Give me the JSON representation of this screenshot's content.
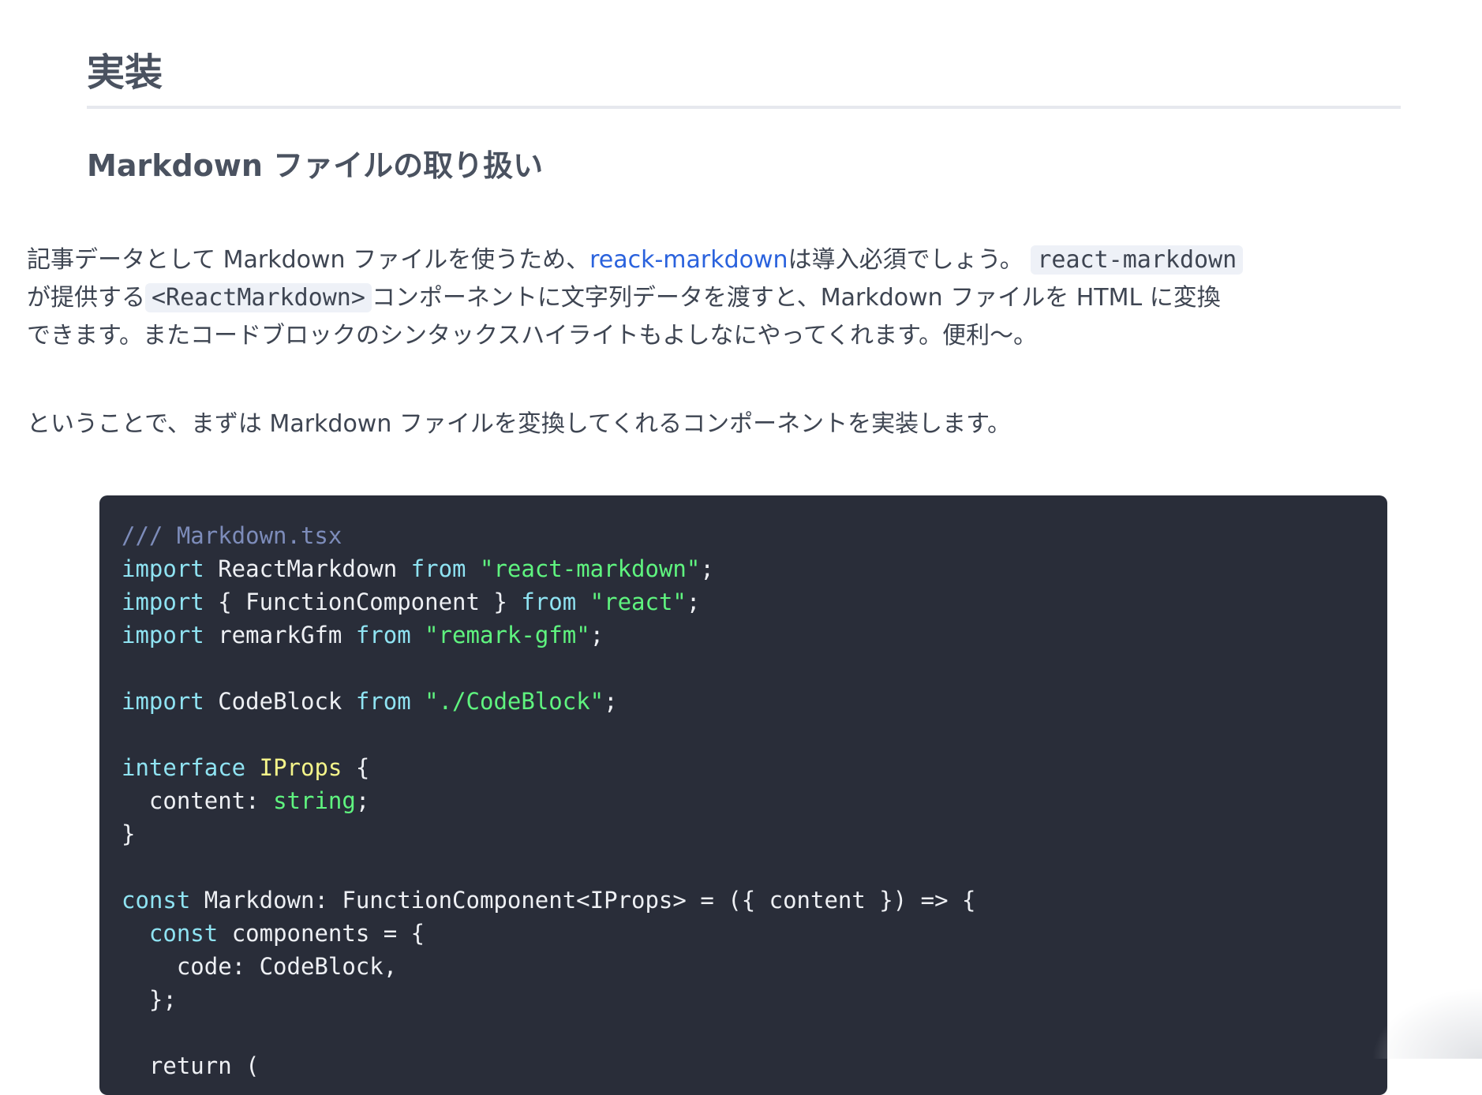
{
  "heading_h2": "実装",
  "heading_h3": "Markdown ファイルの取り扱い",
  "para1": {
    "t1": "記事データとして Markdown ファイルを使うため、",
    "link": "reack-markdown",
    "t2": "は導入必須でしょう。",
    "code1": "react-markdown",
    "t3": "が提供する",
    "code2": "<ReactMarkdown>",
    "t4": "コンポーネントに文字列データを渡すと、Markdown ファイルを HTML に変換",
    "t5": "できます。またコードブロックのシンタックスハイライトもよしなにやってくれます。便利〜。"
  },
  "para2": "ということで、まずは Markdown ファイルを変換してくれるコンポーネントを実装します。",
  "code": {
    "l1": "/// Markdown.tsx",
    "l2": [
      {
        "t": "import",
        "c": "kw"
      },
      {
        "t": " ReactMarkdown ",
        "c": ""
      },
      {
        "t": "from",
        "c": "kw"
      },
      {
        "t": " ",
        "c": ""
      },
      {
        "t": "\"react-markdown\"",
        "c": "str"
      },
      {
        "t": ";",
        "c": ""
      }
    ],
    "l3": [
      {
        "t": "import",
        "c": "kw"
      },
      {
        "t": " { FunctionComponent } ",
        "c": ""
      },
      {
        "t": "from",
        "c": "kw"
      },
      {
        "t": " ",
        "c": ""
      },
      {
        "t": "\"react\"",
        "c": "str"
      },
      {
        "t": ";",
        "c": ""
      }
    ],
    "l4": [
      {
        "t": "import",
        "c": "kw"
      },
      {
        "t": " remarkGfm ",
        "c": ""
      },
      {
        "t": "from",
        "c": "kw"
      },
      {
        "t": " ",
        "c": ""
      },
      {
        "t": "\"remark-gfm\"",
        "c": "str"
      },
      {
        "t": ";",
        "c": ""
      }
    ],
    "l6": [
      {
        "t": "import",
        "c": "kw"
      },
      {
        "t": " CodeBlock ",
        "c": ""
      },
      {
        "t": "from",
        "c": "kw"
      },
      {
        "t": " ",
        "c": ""
      },
      {
        "t": "\"./CodeBlock\"",
        "c": "str"
      },
      {
        "t": ";",
        "c": ""
      }
    ],
    "l8": [
      {
        "t": "interface",
        "c": "kw"
      },
      {
        "t": " ",
        "c": ""
      },
      {
        "t": "IProps",
        "c": "type"
      },
      {
        "t": " {",
        "c": ""
      }
    ],
    "l9": [
      {
        "t": "  content: ",
        "c": ""
      },
      {
        "t": "string",
        "c": "builtin"
      },
      {
        "t": ";",
        "c": ""
      }
    ],
    "l10": [
      {
        "t": "}",
        "c": ""
      }
    ],
    "l12": [
      {
        "t": "const",
        "c": "kw"
      },
      {
        "t": " Markdown: FunctionComponent<IProps> = ({ content }) => {",
        "c": ""
      }
    ],
    "l13": [
      {
        "t": "  ",
        "c": ""
      },
      {
        "t": "const",
        "c": "kw"
      },
      {
        "t": " components = {",
        "c": ""
      }
    ],
    "l14": [
      {
        "t": "    code: CodeBlock,",
        "c": ""
      }
    ],
    "l15": [
      {
        "t": "  };",
        "c": ""
      }
    ],
    "l17": [
      {
        "t": "  return (",
        "c": ""
      }
    ]
  }
}
